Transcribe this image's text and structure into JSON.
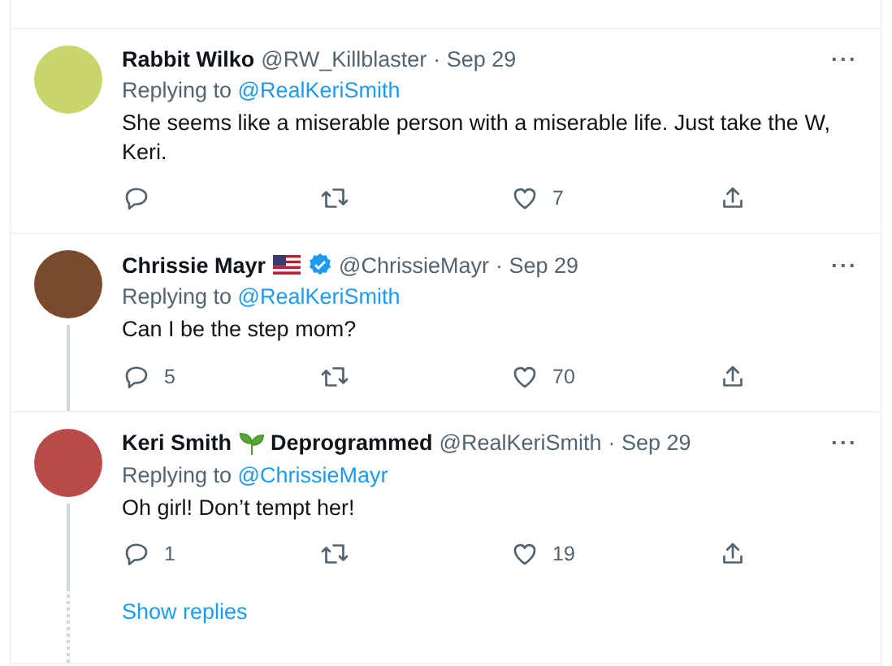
{
  "tweets": [
    {
      "name": [
        {
          "kind": "text",
          "text": "Rabbit Wilko"
        }
      ],
      "verified": false,
      "handle": "@RW_Killblaster",
      "time": "· Sep 29",
      "more": "···",
      "thread_line": false,
      "replying_label": "Replying to",
      "replying_to": "@RealKeriSmith",
      "text": "She seems like a miserable person with a miserable life. Just take the W, Keri.",
      "actions": [
        {
          "kind": "reply"
        },
        {
          "kind": "retweet"
        },
        {
          "kind": "like",
          "count": "7"
        },
        {
          "kind": "share"
        }
      ]
    },
    {
      "name": [
        {
          "kind": "text",
          "text": "Chrissie Mayr"
        },
        {
          "kind": "flag"
        }
      ],
      "verified": true,
      "handle": "@ChrissieMayr",
      "time": "· Sep 29",
      "more": "···",
      "thread_line": true,
      "replying_label": "Replying to",
      "replying_to": "@RealKeriSmith",
      "text": "Can I be the step mom?",
      "actions": [
        {
          "kind": "reply",
          "count": "5"
        },
        {
          "kind": "retweet"
        },
        {
          "kind": "like",
          "count": "70"
        },
        {
          "kind": "share"
        }
      ]
    },
    {
      "name": [
        {
          "kind": "text",
          "text": "Keri Smith"
        },
        {
          "kind": "sprout"
        },
        {
          "kind": "text",
          "text": "Deprogrammed"
        }
      ],
      "verified": false,
      "handle": "@RealKeriSmith",
      "time": "· Sep 29",
      "more": "···",
      "thread_line": true,
      "replying_label": "Replying to",
      "replying_to": "@ChrissieMayr",
      "text": "Oh girl! Don’t tempt her!",
      "actions": [
        {
          "kind": "reply",
          "count": "1"
        },
        {
          "kind": "retweet"
        },
        {
          "kind": "like",
          "count": "19"
        },
        {
          "kind": "share"
        }
      ]
    }
  ],
  "show_replies": "Show replies"
}
